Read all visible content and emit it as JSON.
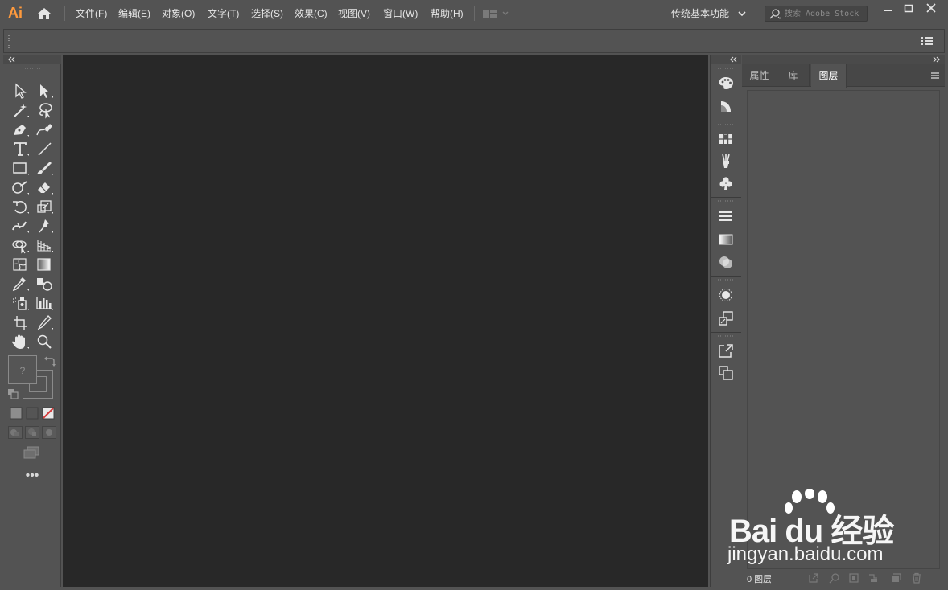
{
  "app": {
    "logo_text": "Ai",
    "accent": "#ff9a3d"
  },
  "menu": {
    "items": [
      "文件(F)",
      "编辑(E)",
      "对象(O)",
      "文字(T)",
      "选择(S)",
      "效果(C)",
      "视图(V)",
      "窗口(W)",
      "帮助(H)"
    ]
  },
  "workspace": {
    "label": "传统基本功能"
  },
  "search": {
    "placeholder": "搜索 Adobe Stock"
  },
  "fill_stroke": {
    "fill_label": "?"
  },
  "toolbar": {
    "more_label": "•••"
  },
  "panel": {
    "tabs": [
      {
        "label": "属性",
        "active": false
      },
      {
        "label": "库",
        "active": false
      },
      {
        "label": "图层",
        "active": true
      }
    ],
    "footer_count": "0 图层"
  },
  "watermark": {
    "brand": "Bai du 经验",
    "url": "jingyan.baidu.com"
  },
  "colors": {
    "chrome": "#535353",
    "canvas": "#282828",
    "dark_strip": "#4a4a4a"
  }
}
